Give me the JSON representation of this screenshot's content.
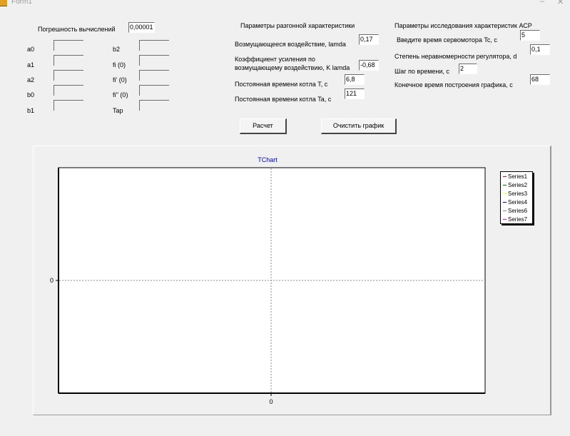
{
  "window": {
    "title": "Form1",
    "minimize_glyph": "–",
    "close_glyph": "✕"
  },
  "left": {
    "precision_label": "Погрешность вычислений",
    "precision_value": "0,00001",
    "params": [
      "a0",
      "a1",
      "a2",
      "b0",
      "b1",
      "b2",
      "fi (0)",
      "fi' (0)",
      "fi'' (0)",
      "Tap"
    ]
  },
  "middle": {
    "header": "Параметры разгонной характеристики",
    "disturbance_label": "Возмущающееся воздействие, lamda",
    "disturbance_value": "0,17",
    "gain_label_line1": "Коэффициент усиления по",
    "gain_label_line2": "возмущающему воздействию, K lamda",
    "gain_value": "-0,68",
    "boiler_T_label": "Постоянная времени котла  T, c",
    "boiler_T_value": "6,8",
    "boiler_Ta_label": "Постоянная времени котла  Ta, c",
    "boiler_Ta_value": "121"
  },
  "right": {
    "header": "Параметры исследования характеристик АСР",
    "servo_label": "Введите время сервомотора Tc, c",
    "servo_value": "5",
    "nonuniformity_label": "Степень неравномерности регулятора, d",
    "nonuniformity_value": "0,1",
    "step_label": "Шаг по времени, c",
    "step_value": "2",
    "end_time_label": "Конечное время построения  графика, c",
    "end_time_value": "68"
  },
  "buttons": {
    "calculate": "Расчет",
    "clear_chart": "Очистить график"
  },
  "chart_data": {
    "type": "line",
    "title": "TChart",
    "x_tick_labels": [
      "0"
    ],
    "y_tick_labels": [
      "0"
    ],
    "series": [
      {
        "name": "Series1",
        "color": "#ff0000",
        "values": []
      },
      {
        "name": "Series2",
        "color": "#008000",
        "values": []
      },
      {
        "name": "Series3",
        "color": "#ffff00",
        "values": []
      },
      {
        "name": "Series4",
        "color": "#0000ff",
        "values": []
      },
      {
        "name": "Series6",
        "color": "#808080",
        "values": []
      },
      {
        "name": "Series7",
        "color": "#ff00ff",
        "values": []
      }
    ],
    "grid": true,
    "legend_position": "right"
  }
}
